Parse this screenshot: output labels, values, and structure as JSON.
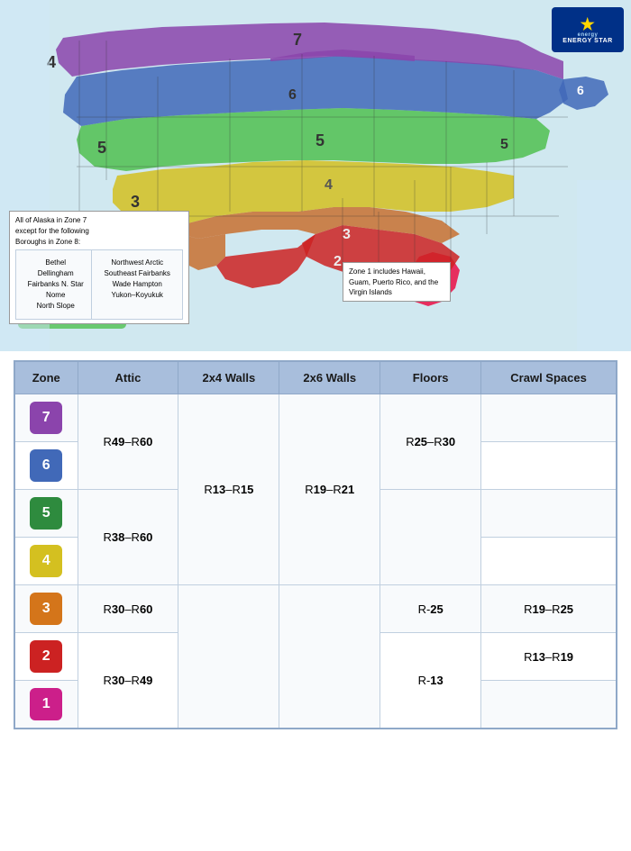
{
  "map": {
    "alaska_note": {
      "line1": "All of Alaska in Zone 7",
      "line2": "except for the following",
      "line3": "Boroughs in Zone 8:",
      "col1": [
        "Bethel",
        "Dellingham",
        "Fairbanks N. Star",
        "Nome",
        "North Slope"
      ],
      "col2": [
        "Northwest Arctic",
        "Southeast Fairbanks",
        "Wade Hampton",
        "Yukon–Koyukuk"
      ]
    },
    "zone1_note": {
      "text": "Zone 1 includes Hawaii, Guam, Puerto Rico, and the Virgin Islands"
    }
  },
  "energy_star": {
    "label": "ENERGY STAR"
  },
  "table": {
    "headers": {
      "zone": "Zone",
      "attic": "Attic",
      "walls_2x4": "2x4 Walls",
      "walls_2x6": "2x6 Walls",
      "floors": "Floors",
      "crawl_spaces": "Crawl Spaces"
    },
    "rows": [
      {
        "zone_number": "7",
        "zone_color_class": "zone-7",
        "attic": "R49–R60",
        "walls_2x4": "",
        "walls_2x6": "",
        "floors": "",
        "crawl_spaces": ""
      },
      {
        "zone_number": "6",
        "zone_color_class": "zone-6",
        "attic": "",
        "walls_2x4": "",
        "walls_2x6": "",
        "floors": "R25–R30",
        "crawl_spaces": ""
      },
      {
        "zone_number": "5",
        "zone_color_class": "zone-5",
        "attic": "R38–R60",
        "walls_2x4": "R13–R15",
        "walls_2x6": "R19–R21",
        "floors": "",
        "crawl_spaces": ""
      },
      {
        "zone_number": "4",
        "zone_color_class": "zone-4",
        "attic": "",
        "walls_2x4": "",
        "walls_2x6": "",
        "floors": "",
        "crawl_spaces": ""
      },
      {
        "zone_number": "3",
        "zone_color_class": "zone-3",
        "attic": "R30–R60",
        "walls_2x4": "",
        "walls_2x6": "",
        "floors": "R-25",
        "crawl_spaces": "R19–R25"
      },
      {
        "zone_number": "2",
        "zone_color_class": "zone-2",
        "attic": "R30–R49",
        "walls_2x4": "",
        "walls_2x6": "",
        "floors": "R-13",
        "crawl_spaces": "R13–R19"
      },
      {
        "zone_number": "1",
        "zone_color_class": "zone-1",
        "attic": "",
        "walls_2x4": "",
        "walls_2x6": "",
        "floors": "",
        "crawl_spaces": ""
      }
    ]
  }
}
